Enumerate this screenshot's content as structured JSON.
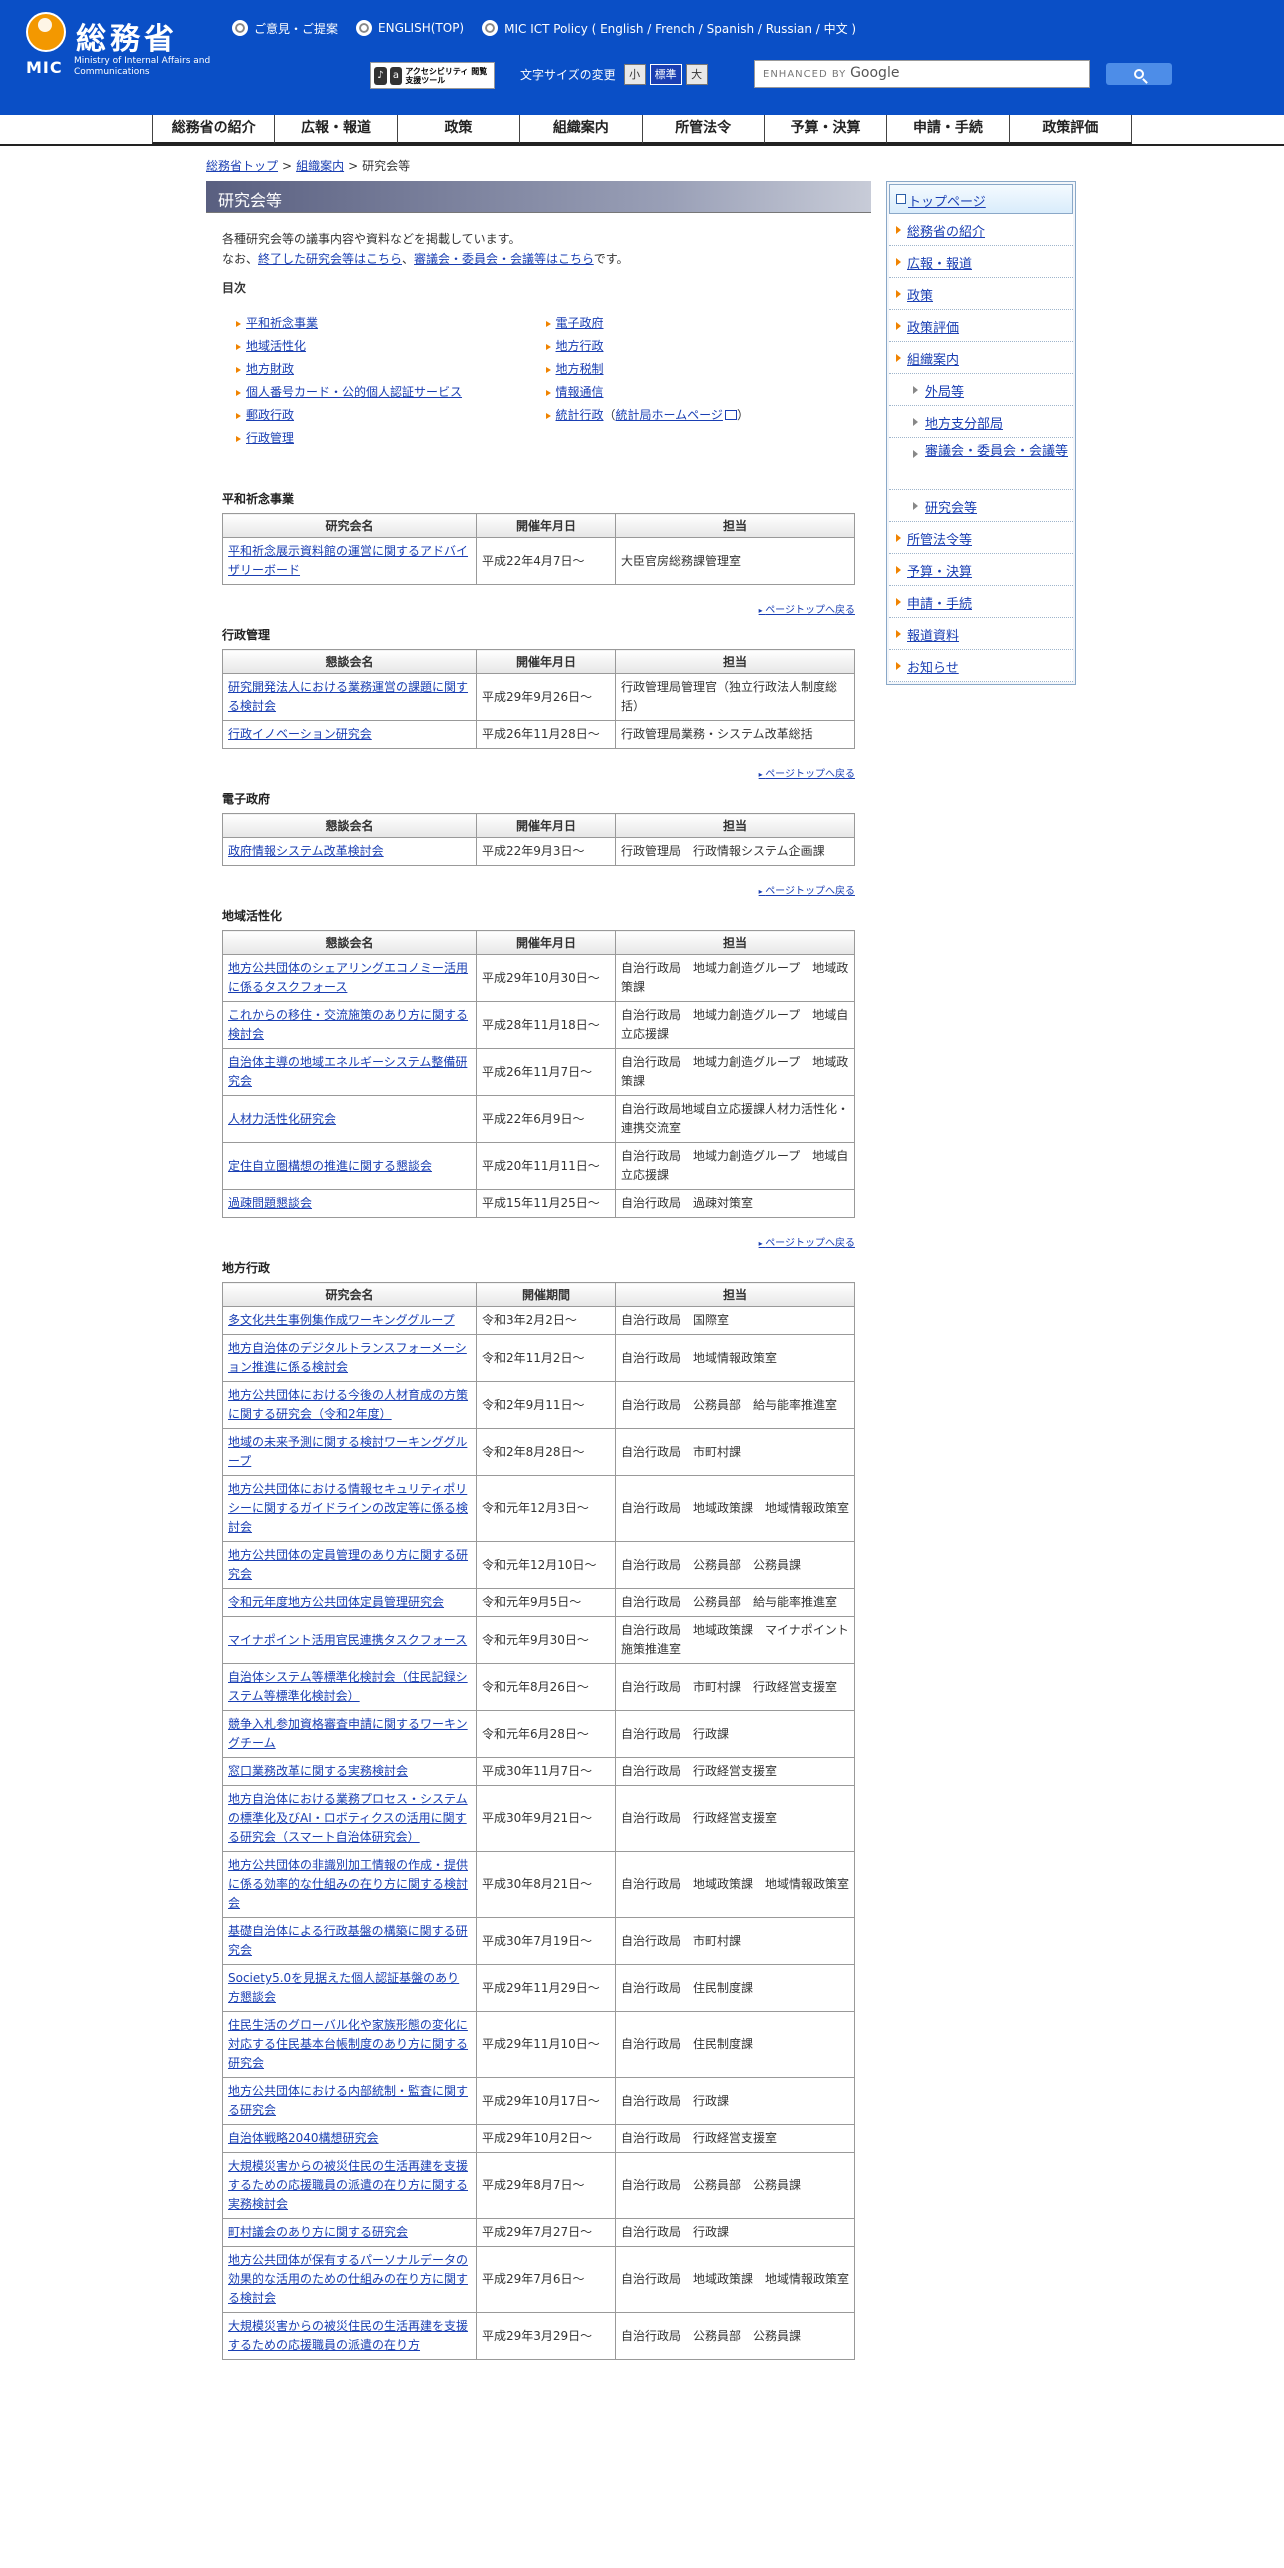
{
  "header": {
    "logo_jp": "総務省",
    "logo_mic": "MIC",
    "logo_en": "Ministry of Internal Affairs and Communications",
    "toplinks": [
      "ご意見・ご提案",
      "ENGLISH(TOP)",
      "MIC ICT Policy ( English / French / Spanish / Russian / 中文 )"
    ],
    "access_tool": "アクセシビリティ 閲覧支援ツール",
    "fontsize_label": "文字サイズの変更",
    "fontsize_small": "小",
    "fontsize_standard": "標準",
    "fontsize_large": "大",
    "search_enhanced": "ENHANCED BY",
    "search_google": "Google"
  },
  "gnav": [
    "総務省の紹介",
    "広報・報道",
    "政策",
    "組織案内",
    "所管法令",
    "予算・決算",
    "申請・手続",
    "政策評価"
  ],
  "breadcrumb": [
    "総務省トップ",
    "組織案内",
    "研究会等"
  ],
  "page_title": "研究会等",
  "intro": {
    "line1": "各種研究会等の議事内容や資料などを掲載しています。",
    "line2_prefix": "なお、",
    "link1": "終了した研究会等はこちら",
    "mid": "、",
    "link2": "審議会・委員会・会議等はこちら",
    "suffix": "です。"
  },
  "toc_title": "目次",
  "toc_left": [
    "平和祈念事業",
    "地域活性化",
    "地方財政",
    "個人番号カード・公的個人認証サービス",
    "郵政行政",
    "行政管理"
  ],
  "toc_right": [
    "電子政府",
    "地方行政",
    "地方税制",
    "情報通信",
    "統計行政"
  ],
  "toc_stat_link": "統計局ホームページ",
  "pagetop": "ページトップへ戻る",
  "sections": [
    {
      "title": "平和祈念事業",
      "headers": [
        "研究会名",
        "開催年月日",
        "担当"
      ],
      "rows": [
        [
          "平和祈念展示資料館の運営に関するアドバイザリーボード",
          "平成22年4月7日～",
          "大臣官房総務課管理室"
        ]
      ]
    },
    {
      "title": "行政管理",
      "headers": [
        "懇談会名",
        "開催年月日",
        "担当"
      ],
      "rows": [
        [
          "研究開発法人における業務運営の課題に関する検討会",
          "平成29年9月26日～",
          "行政管理局管理官（独立行政法人制度総括）"
        ],
        [
          "行政イノベーション研究会",
          "平成26年11月28日～",
          "行政管理局業務・システム改革総括"
        ]
      ]
    },
    {
      "title": "電子政府",
      "headers": [
        "懇談会名",
        "開催年月日",
        "担当"
      ],
      "rows": [
        [
          "政府情報システム改革検討会",
          "平成22年9月3日～",
          "行政管理局　行政情報システム企画課"
        ]
      ]
    },
    {
      "title": "地域活性化",
      "headers": [
        "懇談会名",
        "開催年月日",
        "担当"
      ],
      "rows": [
        [
          "地方公共団体のシェアリングエコノミー活用に係るタスクフォース",
          "平成29年10月30日～",
          "自治行政局　地域力創造グループ　地域政策課"
        ],
        [
          "これからの移住・交流施策のあり方に関する検討会",
          "平成28年11月18日～",
          "自治行政局　地域力創造グループ　地域自立応援課"
        ],
        [
          "自治体主導の地域エネルギーシステム整備研究会",
          "平成26年11月7日～",
          "自治行政局　地域力創造グループ　地域政策課"
        ],
        [
          "人材力活性化研究会",
          "平成22年6月9日～",
          "自治行政局地域自立応援課人材力活性化・連携交流室"
        ],
        [
          "定住自立圏構想の推進に関する懇談会",
          "平成20年11月11日～",
          "自治行政局　地域力創造グループ　地域自立応援課"
        ],
        [
          "過疎問題懇談会",
          "平成15年11月25日～",
          "自治行政局　過疎対策室"
        ]
      ]
    },
    {
      "title": "地方行政",
      "headers": [
        "研究会名",
        "開催期間",
        "担当"
      ],
      "rows": [
        [
          "多文化共生事例集作成ワーキンググループ",
          "令和3年2月2日～",
          "自治行政局　国際室"
        ],
        [
          "地方自治体のデジタルトランスフォーメーション推進に係る検討会",
          "令和2年11月2日～",
          "自治行政局　地域情報政策室"
        ],
        [
          "地方公共団体における今後の人材育成の方策に関する研究会（令和2年度）",
          "令和2年9月11日～",
          "自治行政局　公務員部　給与能率推進室"
        ],
        [
          "地域の未来予測に関する検討ワーキンググループ",
          "令和2年8月28日～",
          "自治行政局　市町村課"
        ],
        [
          "地方公共団体における情報セキュリティポリシーに関するガイドラインの改定等に係る検討会",
          "令和元年12月3日～",
          "自治行政局　地域政策課　地域情報政策室"
        ],
        [
          "地方公共団体の定員管理のあり方に関する研究会",
          "令和元年12月10日～",
          "自治行政局　公務員部　公務員課"
        ],
        [
          "令和元年度地方公共団体定員管理研究会",
          "令和元年9月5日～",
          "自治行政局　公務員部　給与能率推進室"
        ],
        [
          "マイナポイント活用官民連携タスクフォース",
          "令和元年9月30日～",
          "自治行政局　地域政策課　マイナポイント施策推進室"
        ],
        [
          "自治体システム等標準化検討会（住民記録システム等標準化検討会）",
          "令和元年8月26日～",
          "自治行政局　市町村課　行政経営支援室"
        ],
        [
          "競争入札参加資格審査申請に関するワーキングチーム",
          "令和元年6月28日～",
          "自治行政局　行政課"
        ],
        [
          "窓口業務改革に関する実務検討会",
          "平成30年11月7日～",
          "自治行政局　行政経営支援室"
        ],
        [
          "地方自治体における業務プロセス・システムの標準化及びAI・ロボティクスの活用に関する研究会（スマート自治体研究会）",
          "平成30年9月21日～",
          "自治行政局　行政経営支援室"
        ],
        [
          "地方公共団体の非識別加工情報の作成・提供に係る効率的な仕組みの在り方に関する検討会",
          "平成30年8月21日～",
          "自治行政局　地域政策課　地域情報政策室"
        ],
        [
          "基礎自治体による行政基盤の構築に関する研究会",
          "平成30年7月19日～",
          "自治行政局　市町村課"
        ],
        [
          "Society5.0を見据えた個人認証基盤のあり方懇談会",
          "平成29年11月29日～",
          "自治行政局　住民制度課"
        ],
        [
          "住民生活のグローバル化や家族形態の変化に対応する住民基本台帳制度のあり方に関する研究会",
          "平成29年11月10日～",
          "自治行政局　住民制度課"
        ],
        [
          "地方公共団体における内部統制・監査に関する研究会",
          "平成29年10月17日～",
          "自治行政局　行政課"
        ],
        [
          "自治体戦略2040構想研究会",
          "平成29年10月2日～",
          "自治行政局　行政経営支援室"
        ],
        [
          "大規模災害からの被災住民の生活再建を支援するための応援職員の派遣の在り方に関する実務検討会",
          "平成29年8月7日～",
          "自治行政局　公務員部　公務員課"
        ],
        [
          "町村議会のあり方に関する研究会",
          "平成29年7月27日～",
          "自治行政局　行政課"
        ],
        [
          "地方公共団体が保有するパーソナルデータの効果的な活用のための仕組みの在り方に関する検討会",
          "平成29年7月6日～",
          "自治行政局　地域政策課　地域情報政策室"
        ],
        [
          "大規模災害からの被災住民の生活再建を支援するための応援職員の派遣の在り方",
          "平成29年3月29日～",
          "自治行政局　公務員部　公務員課"
        ]
      ]
    }
  ],
  "side": {
    "top": "トップページ",
    "items": [
      {
        "label": "総務省の紹介",
        "sub": false
      },
      {
        "label": "広報・報道",
        "sub": false
      },
      {
        "label": "政策",
        "sub": false
      },
      {
        "label": "政策評価",
        "sub": false
      },
      {
        "label": "組織案内",
        "sub": false
      },
      {
        "label": "外局等",
        "sub": true
      },
      {
        "label": "地方支分部局",
        "sub": true
      },
      {
        "label": "審議会・委員会・会議等",
        "sub": true
      },
      {
        "label": "研究会等",
        "sub": true
      },
      {
        "label": "所管法令等",
        "sub": false
      },
      {
        "label": "予算・決算",
        "sub": false
      },
      {
        "label": "申請・手続",
        "sub": false
      },
      {
        "label": "報道資料",
        "sub": false
      },
      {
        "label": "お知らせ",
        "sub": false
      }
    ]
  }
}
